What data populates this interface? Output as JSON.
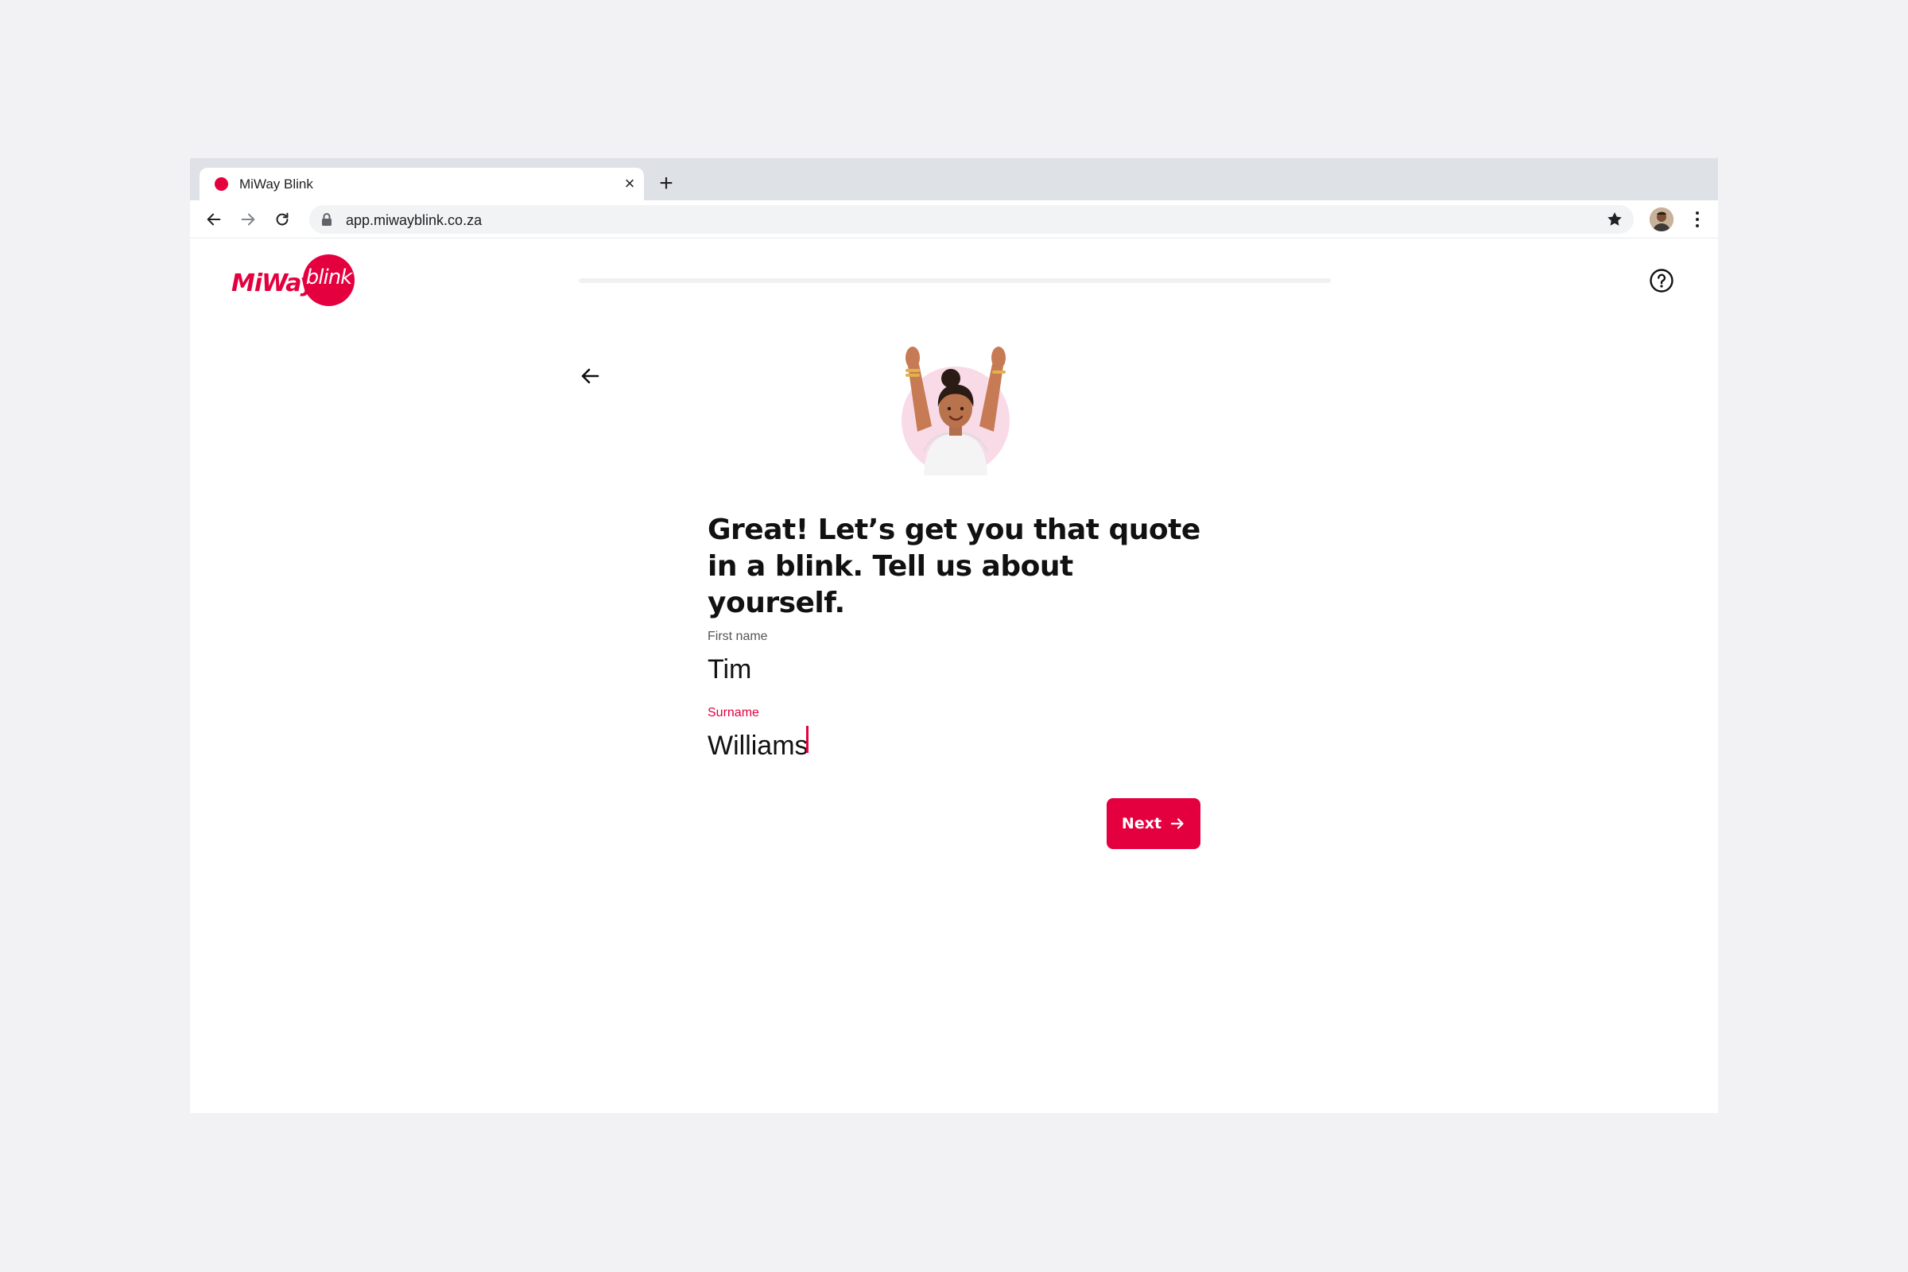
{
  "browser": {
    "tab": {
      "title": "MiWay Blink"
    },
    "url": "app.miwayblink.co.za"
  },
  "header": {
    "logo": {
      "primary": "MiWay",
      "secondary": "blink"
    },
    "progress": 0.0
  },
  "form": {
    "heading": "Great! Let’s get you that quote in a blink. Tell us about yourself.",
    "fields": [
      {
        "label": "First name",
        "value": "Tim"
      },
      {
        "label": "Surname",
        "value": "Williams"
      }
    ],
    "next_label": "Next"
  },
  "colors": {
    "brand": "#e4003f",
    "page_background": "#f2f2f4",
    "tabstrip": "#dee1e6"
  },
  "icons": {
    "back": "arrow-left-icon",
    "help": "question-circle-icon",
    "next": "arrow-right-icon",
    "lock": "lock-icon",
    "bookmark": "star-icon"
  }
}
